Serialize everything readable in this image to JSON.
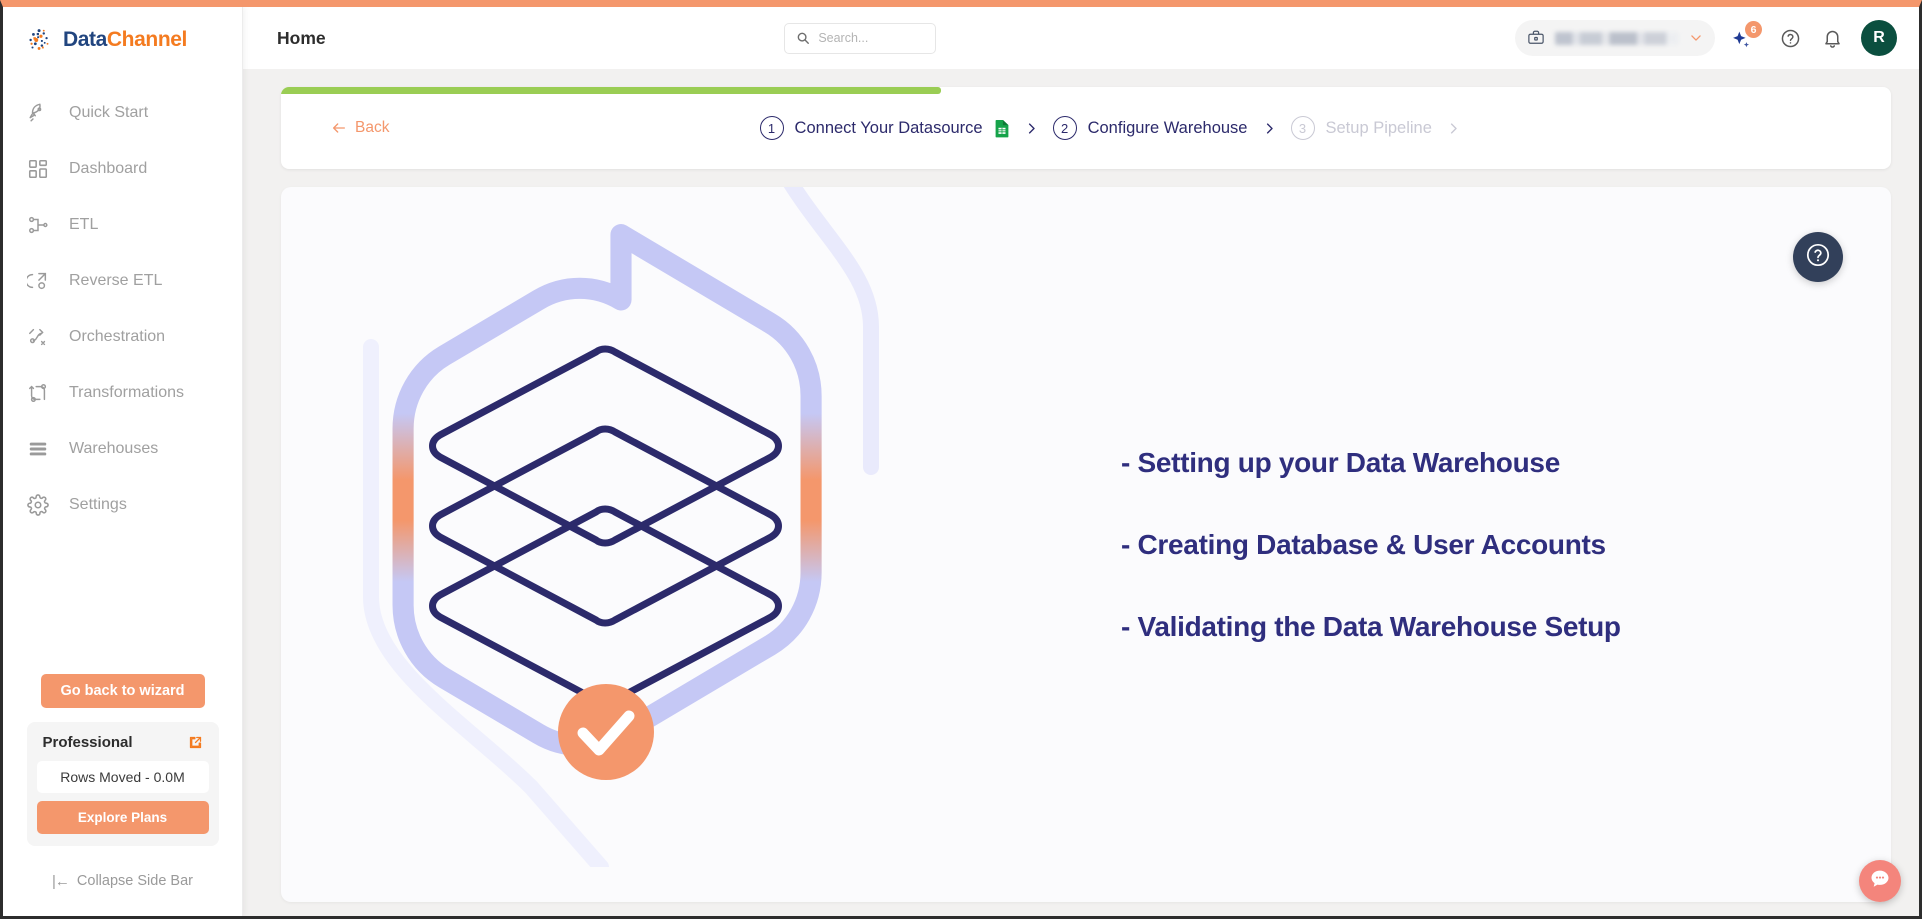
{
  "brand": {
    "name_part1": "Data",
    "name_part2": "Channel",
    "accent_orange": "#f4976c",
    "accent_blue": "#21457f",
    "progress_green": "#9acd54",
    "step_navy": "#2c2a6b"
  },
  "sidebar": {
    "items": [
      {
        "label": "Quick Start",
        "icon": "rocket-icon"
      },
      {
        "label": "Dashboard",
        "icon": "grid-icon"
      },
      {
        "label": "ETL",
        "icon": "etl-icon"
      },
      {
        "label": "Reverse ETL",
        "icon": "reverse-etl-icon"
      },
      {
        "label": "Orchestration",
        "icon": "orchestration-icon"
      },
      {
        "label": "Transformations",
        "icon": "transformations-icon"
      },
      {
        "label": "Warehouses",
        "icon": "warehouses-icon"
      },
      {
        "label": "Settings",
        "icon": "gear-icon"
      }
    ],
    "wizard_button": "Go back to wizard",
    "plan": {
      "name": "Professional",
      "rows_moved": "Rows Moved - 0.0M",
      "explore_button": "Explore Plans"
    },
    "collapse": {
      "glyph": "|←",
      "label": "Collapse Side Bar"
    }
  },
  "header": {
    "page_title": "Home",
    "search": {
      "value": "",
      "placeholder": "Search..."
    },
    "workspace": {
      "name": "",
      "icon": "briefcase-icon"
    },
    "sparkle_badge": "6",
    "avatar_initial": "R"
  },
  "stepper": {
    "progress_percent": 41,
    "back_label": "Back",
    "steps": [
      {
        "number": "1",
        "label": "Connect Your Datasource",
        "state": "done",
        "trailing_icon": "google-sheets-icon"
      },
      {
        "number": "2",
        "label": "Configure Warehouse",
        "state": "active",
        "trailing_icon": ""
      },
      {
        "number": "3",
        "label": "Setup Pipeline",
        "state": "disabled",
        "trailing_icon": ""
      }
    ]
  },
  "main": {
    "bullets": [
      "- Setting up your Data Warehouse",
      "- Creating Database & User Accounts",
      "- Validating the Data Warehouse Setup"
    ],
    "illustration": {
      "name": "data-warehouse-layers-illustration",
      "status": "success-check"
    }
  },
  "fabs": {
    "help": "help-circle-icon",
    "chat": "chat-bubble-icon"
  }
}
